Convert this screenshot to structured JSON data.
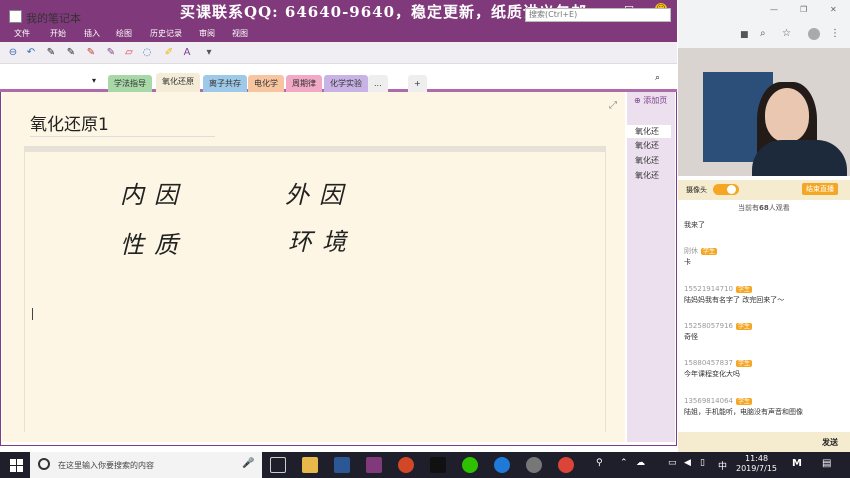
{
  "window": {
    "watermark": "买课联系QQ: 64640-9640，稳定更新，纸质讲义包邮",
    "minimize": "—",
    "maximize": "☐",
    "close": "✕"
  },
  "menu": [
    "文件",
    "开始",
    "插入",
    "绘图",
    "历史记录",
    "审阅",
    "视图"
  ],
  "notebook": {
    "name": "我的笔记本",
    "tabs": [
      "学法指导",
      "氧化还原",
      "离子共存",
      "电化学",
      "周期律",
      "化学实验",
      "...",
      "+"
    ],
    "search_placeholder": "搜索(Ctrl+E)"
  },
  "page": {
    "title": "氧化还原1",
    "handwriting": [
      "内因",
      "外因",
      "性质",
      "环境"
    ]
  },
  "pages_pane": {
    "add_label": "添加页",
    "items": [
      "氧化还",
      "氧化还",
      "氧化还",
      "氧化还"
    ]
  },
  "live": {
    "camera_label": "摄像头",
    "end_button": "结束直播",
    "viewer_prefix": "当前有",
    "viewer_count": "68",
    "viewer_suffix": "人观看",
    "badge": "学生",
    "chat": [
      {
        "user": "",
        "msg": "我来了"
      },
      {
        "user": "刚休",
        "msg": "卡"
      },
      {
        "user": "15521914710",
        "msg": "陆妈妈我有名字了 改完回来了～"
      },
      {
        "user": "15258057916",
        "msg": "奇怪"
      },
      {
        "user": "15880457837",
        "msg": "今年课程变化大吗"
      },
      {
        "user": "13569814064",
        "msg": "陆姐，手机能听，电脑没有声音和图像"
      }
    ],
    "send": "发送"
  },
  "taskbar": {
    "search_placeholder": "在这里输入你要搜索的内容",
    "time": "11:48",
    "date": "2019/7/15",
    "ime": "中"
  },
  "colors": {
    "onenote_purple": "#80397b",
    "page_bg": "#fdf6e4",
    "taskbar": "#1f1f2b"
  }
}
